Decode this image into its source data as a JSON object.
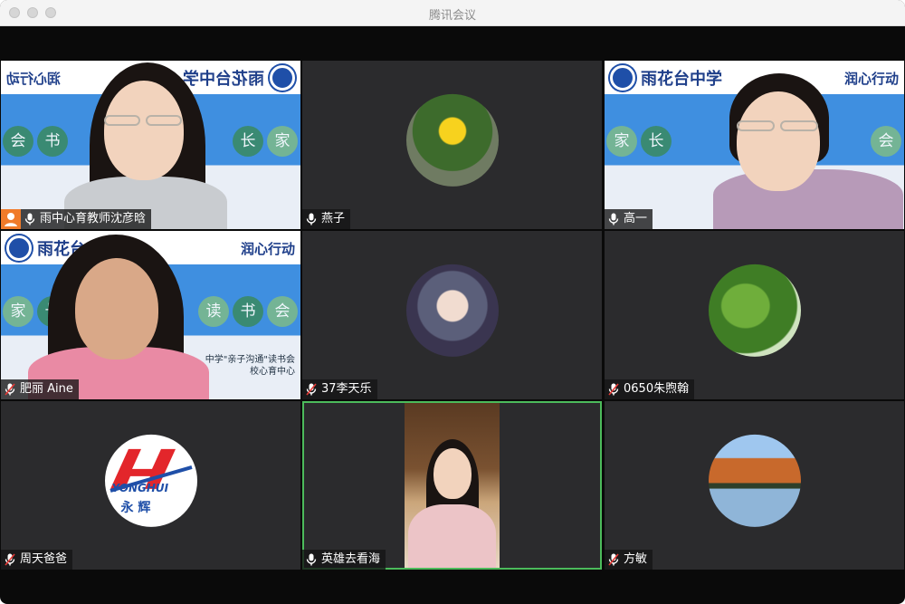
{
  "window": {
    "title": "腾讯会议"
  },
  "colors": {
    "active_border": "#4cbb5b",
    "tile_bg": "#2b2b2d",
    "window_bg": "#0a0a0a"
  },
  "banner": {
    "brand_left": "雨花台中学",
    "brand_right": "润心行动",
    "footer_line1": "中学\"亲子沟通\"读书会",
    "footer_line2": "校心育中心"
  },
  "participants": [
    {
      "name": "雨中心育教师沈彦晗",
      "mic": "on",
      "kind": "video-banner-mirror"
    },
    {
      "name": "燕子",
      "mic": "on",
      "kind": "avatar-flower"
    },
    {
      "name": "高一",
      "mic": "on",
      "kind": "video-banner"
    },
    {
      "name": "肥丽 Aine",
      "mic": "muted",
      "kind": "video-banner"
    },
    {
      "name": "37李天乐",
      "mic": "muted",
      "kind": "avatar-anime"
    },
    {
      "name": "0650朱煦翰",
      "mic": "muted",
      "kind": "avatar-leaves"
    },
    {
      "name": "周天爸爸",
      "mic": "muted",
      "kind": "avatar-logo",
      "logo_text": "YONGHUI",
      "logo_sub": "永 辉"
    },
    {
      "name": "英雄去看海",
      "mic": "on",
      "kind": "video-portrait",
      "active": true
    },
    {
      "name": "方敏",
      "mic": "muted",
      "kind": "avatar-trees"
    }
  ],
  "banner_bubbles": {
    "a": "会",
    "b": "书",
    "c": "读",
    "d": "长",
    "e": "家"
  }
}
